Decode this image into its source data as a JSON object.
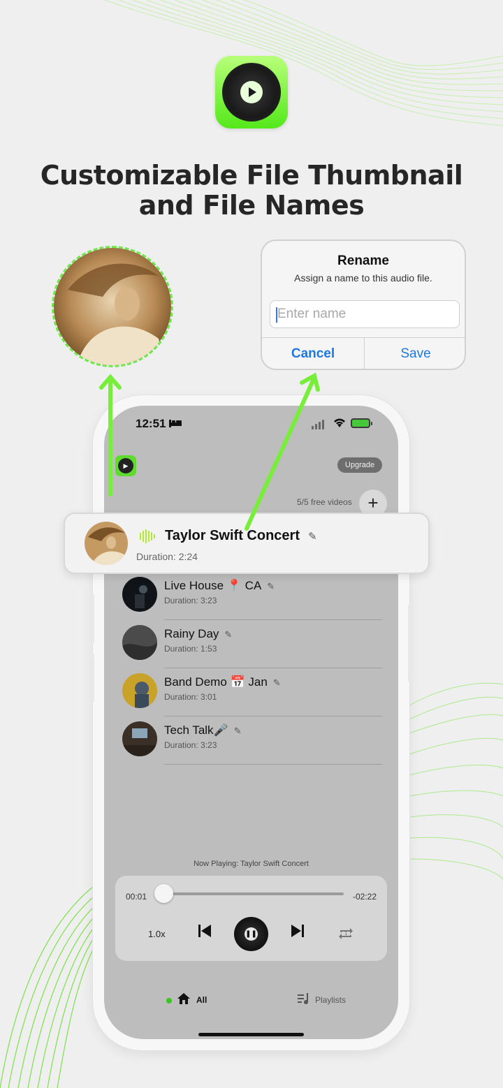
{
  "headline": {
    "line1": "Customizable File Thumbnail",
    "line2": "and File Names"
  },
  "rename_dialog": {
    "title": "Rename",
    "subtitle": "Assign a name to this audio file.",
    "placeholder": "Enter name",
    "cancel": "Cancel",
    "save": "Save"
  },
  "status_bar": {
    "time": "12:51",
    "bed_icon": "bed-icon"
  },
  "header": {
    "upgrade": "Upgrade",
    "free_videos": "5/5 free videos",
    "add": "+"
  },
  "featured_item": {
    "name": "Taylor Swift Concert",
    "duration": "Duration: 2:24"
  },
  "list": [
    {
      "name": "Live House 📍 CA",
      "duration": "Duration: 3:23"
    },
    {
      "name": "Rainy Day",
      "duration": "Duration: 1:53"
    },
    {
      "name": "Band Demo 📅 Jan",
      "duration": "Duration: 3:01"
    },
    {
      "name": "Tech Talk🎤",
      "duration": "Duration: 3:23"
    }
  ],
  "player": {
    "now_playing": "Now Playing: Taylor Swift Concert",
    "elapsed": "00:01",
    "remaining": "-02:22",
    "progress": 0.01,
    "speed": "1.0x"
  },
  "tabs": {
    "all": "All",
    "playlists": "Playlists"
  },
  "colors": {
    "accent": "#6ee84b",
    "link": "#1e78e0",
    "screen_bg": "#bdbdbd"
  }
}
